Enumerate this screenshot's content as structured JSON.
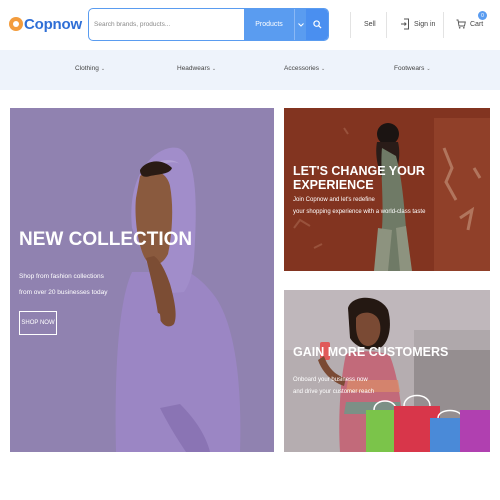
{
  "header": {
    "logo": "Copnow",
    "search": {
      "placeholder": "Search brands, products...",
      "category": "Products"
    },
    "sell": "Sell",
    "signin": "Sign in",
    "cart": "Cart",
    "cart_count": "0"
  },
  "nav": {
    "items": [
      "Clothing",
      "Headwears",
      "Accessories",
      "Footwears"
    ]
  },
  "banners": {
    "main": {
      "title": "NEW COLLECTION",
      "line1": "Shop from fashion collections",
      "line2": "from over 20 businesses today",
      "button": "SHOP NOW"
    },
    "top": {
      "title": "LET'S CHANGE YOUR EXPERIENCE",
      "line1": "Join Copnow and let's redefine",
      "line2": "your shopping experience with a world-class taste"
    },
    "bottom": {
      "title": "GAIN MORE CUSTOMERS",
      "line1": "Onboard your business now",
      "line2": "and drive your customer reach"
    }
  },
  "colors": {
    "accent": "#5a9cf0",
    "brand": "#2f6fd6",
    "nav_bg": "#eef3fb"
  }
}
